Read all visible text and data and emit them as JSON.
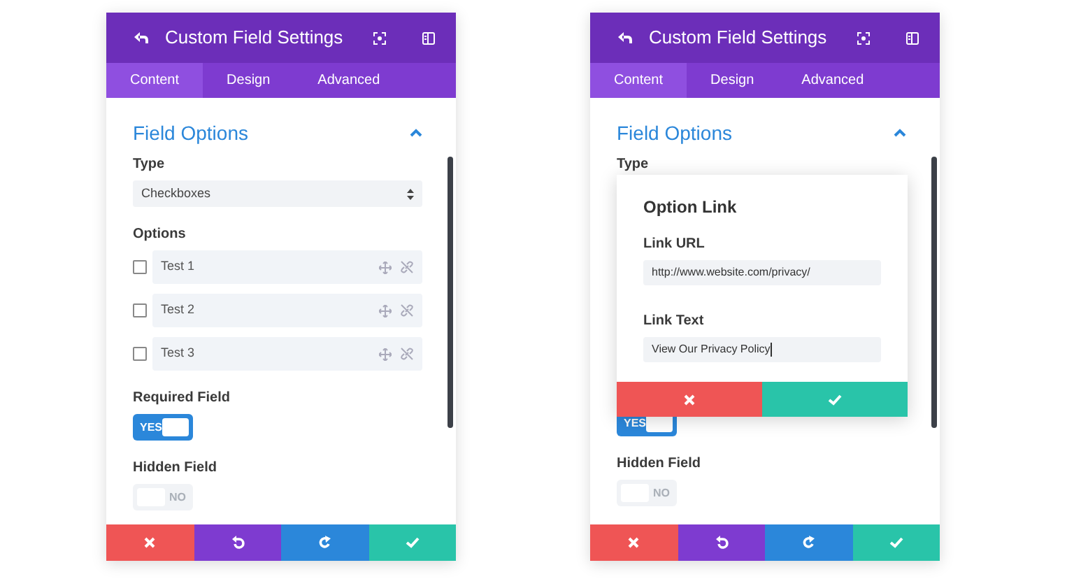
{
  "panels": [
    {
      "title": "Custom Field Settings",
      "tabs": [
        {
          "label": "Content",
          "selected": true
        },
        {
          "label": "Design",
          "selected": false
        },
        {
          "label": "Advanced",
          "selected": false
        }
      ],
      "section": {
        "title": "Field Options",
        "expanded": true
      },
      "fields": [
        {
          "kind": "select",
          "label": "Type",
          "value": "Checkboxes"
        },
        {
          "kind": "options",
          "label": "Options",
          "items": [
            {
              "text": "Test 1",
              "checked": false
            },
            {
              "text": "Test 2",
              "checked": false
            },
            {
              "text": "Test 3",
              "checked": false
            }
          ]
        },
        {
          "kind": "toggle",
          "label": "Required Field",
          "on": true,
          "text": "YES"
        },
        {
          "kind": "toggle",
          "label": "Hidden Field",
          "on": false,
          "text": "NO"
        }
      ]
    },
    {
      "title": "Custom Field Settings",
      "tabs": [
        {
          "label": "Content",
          "selected": true
        },
        {
          "label": "Design",
          "selected": false
        },
        {
          "label": "Advanced",
          "selected": false
        }
      ],
      "section": {
        "title": "Field Options",
        "expanded": true
      },
      "fields": [
        {
          "kind": "label",
          "label": "Type"
        },
        {
          "kind": "toggle",
          "on": true,
          "text": "YES"
        },
        {
          "kind": "toggle",
          "label": "Hidden Field",
          "on": false,
          "text": "NO"
        }
      ],
      "popup": {
        "title": "Option Link",
        "fields": [
          {
            "label": "Link URL",
            "value": "http://www.website.com/privacy/"
          },
          {
            "label": "Link Text",
            "value": "View Our Privacy Policy",
            "focused": true
          }
        ]
      }
    }
  ]
}
